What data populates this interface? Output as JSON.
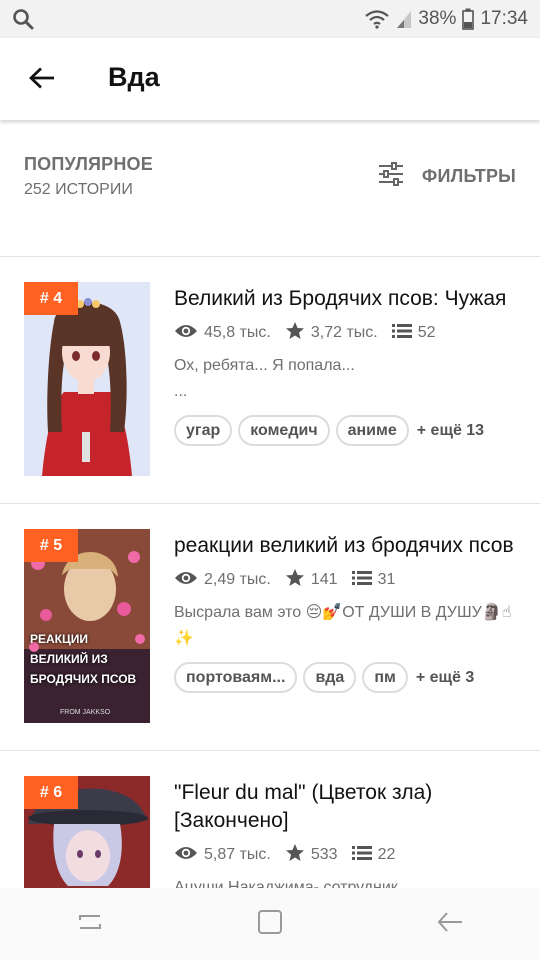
{
  "status_bar": {
    "battery_percent": "38%",
    "time": "17:34",
    "battery_level": 0.38
  },
  "app_bar": {
    "title": "Вда"
  },
  "list_header": {
    "title": "ПОПУЛЯРНОЕ",
    "count": "252 ИСТОРИИ",
    "filters_label": "ФИЛЬТРЫ"
  },
  "stories": [
    {
      "rank": "# 4",
      "title": "Великий из Бродячих псов: Чужая",
      "reads": "45,8 тыс.",
      "votes": "3,72 тыс.",
      "parts": "52",
      "description": "Ох, ребята... Я попала...\n...",
      "tags": [
        "угар",
        "комедич",
        "аниме"
      ],
      "more_tags": "+ ещё 13",
      "cover_text": ""
    },
    {
      "rank": "# 5",
      "title": "реакции великий из бродячих псов",
      "reads": "2,49 тыс.",
      "votes": "141",
      "parts": "31",
      "description": "Высрала вам это 😔💅ОТ ДУШИ В ДУШУ🗿☝✨",
      "tags": [
        "портоваям...",
        "вда",
        "пм"
      ],
      "more_tags": "+ ещё 3",
      "cover_text": "РЕАКЦИИ ВЕЛИКИЙ ИЗ БРОДЯЧИХ ПСОВ",
      "cover_credit": "FROM JAKKSO"
    },
    {
      "rank": "# 6",
      "title": "\"Fleur du mal\" (Цветок зла) [Закончено]",
      "reads": "5,87 тыс.",
      "votes": "533",
      "parts": "22",
      "description": "Ацуши Накаджима- сотрудник",
      "tags": [],
      "more_tags": ""
    }
  ],
  "icons": {
    "search": "search-icon",
    "back": "arrow-left-icon",
    "filters": "sliders-icon",
    "reads": "eye-icon",
    "votes": "star-icon",
    "parts": "list-icon"
  },
  "colors": {
    "accent": "#ff6122",
    "text_secondary": "#6f6f6f"
  }
}
